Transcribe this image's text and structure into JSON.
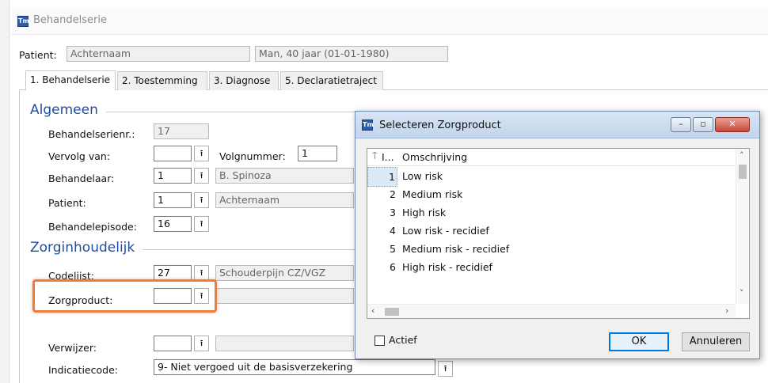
{
  "window": {
    "title": "Behandelserie"
  },
  "patient_bar": {
    "label": "Patient:",
    "name": "Achternaam",
    "info": "Man, 40 jaar (01-01-1980)"
  },
  "tabs": [
    {
      "label": "1. Behandelserie"
    },
    {
      "label": "2. Toestemming"
    },
    {
      "label": "3. Diagnose"
    },
    {
      "label": "5. Declaratietraject"
    }
  ],
  "algemeen": {
    "title": "Algemeen",
    "serienr_label": "Behandelserienr.:",
    "serienr_value": "17",
    "vervolg_label": "Vervolg van:",
    "vervolg_value": "",
    "volgnummer_label": "Volgnummer:",
    "volgnummer_value": "1",
    "behandelaar_label": "Behandelaar:",
    "behandelaar_code": "1",
    "behandelaar_name": "B. Spinoza",
    "patient_label": "Patient:",
    "patient_code": "1",
    "patient_name": "Achternaam",
    "episode_label": "Behandelepisode:",
    "episode_value": "16"
  },
  "zorginhoudelijk": {
    "title": "Zorginhoudelijk",
    "codelijst_label": "Codelijst:",
    "codelijst_code": "27",
    "codelijst_name": "Schouderpijn CZ/VGZ",
    "zorgproduct_label": "Zorgproduct:",
    "zorgproduct_value": "",
    "zorgproduct_name": ""
  },
  "bottom": {
    "verwijzer_label": "Verwijzer:",
    "verwijzer_value": "",
    "indicatie_label": "Indicatiecode:",
    "indicatie_value": "9- Niet vergoed uit de basisverzekering"
  },
  "dialog": {
    "title": "Selecteren Zorgproduct",
    "col_num": "I...",
    "col_desc": "Omschrijving",
    "rows": [
      {
        "num": "1",
        "desc": "Low risk"
      },
      {
        "num": "2",
        "desc": "Medium risk"
      },
      {
        "num": "3",
        "desc": "High risk"
      },
      {
        "num": "4",
        "desc": "Low risk - recidief"
      },
      {
        "num": "5",
        "desc": "Medium risk - recidief"
      },
      {
        "num": "6",
        "desc": "High risk - recidief"
      }
    ],
    "actief_label": "Actief",
    "ok_label": "OK",
    "cancel_label": "Annuleren"
  },
  "colors": {
    "accent": "#1f4fa0",
    "highlight": "#ef7d3a",
    "selection": "#dbeaf8"
  },
  "icons": {
    "picker": "upload-arrow-icon",
    "app": "app-logo-icon",
    "filter": "filter-icon"
  }
}
